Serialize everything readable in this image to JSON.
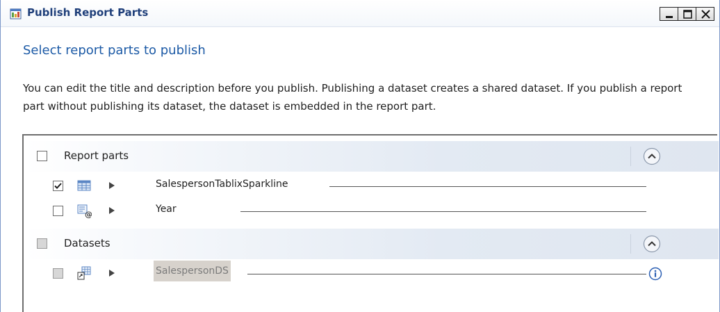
{
  "window": {
    "title": "Publish Report Parts"
  },
  "main": {
    "heading": "Select report parts to publish",
    "description": "You can edit the title and description before you publish. Publishing a dataset creates a shared dataset. If you publish a report part without publishing its dataset, the dataset is embedded in the report part."
  },
  "groups": {
    "report_parts": {
      "label": "Report parts",
      "checked": false,
      "items": [
        {
          "name": "SalespersonTablixSparkline",
          "checked": true,
          "icon": "tablix-icon"
        },
        {
          "name": "Year",
          "checked": false,
          "icon": "parameter-icon"
        }
      ]
    },
    "datasets": {
      "label": "Datasets",
      "checked": false,
      "disabled": true,
      "items": [
        {
          "name": "SalespersonDS",
          "checked": false,
          "disabled": true,
          "icon": "shared-dataset-icon"
        }
      ]
    }
  },
  "colors": {
    "heading": "#1c5aa6",
    "title": "#1f3f7a",
    "header_band": "#dfe6f0",
    "info": "#2b5fb3"
  }
}
